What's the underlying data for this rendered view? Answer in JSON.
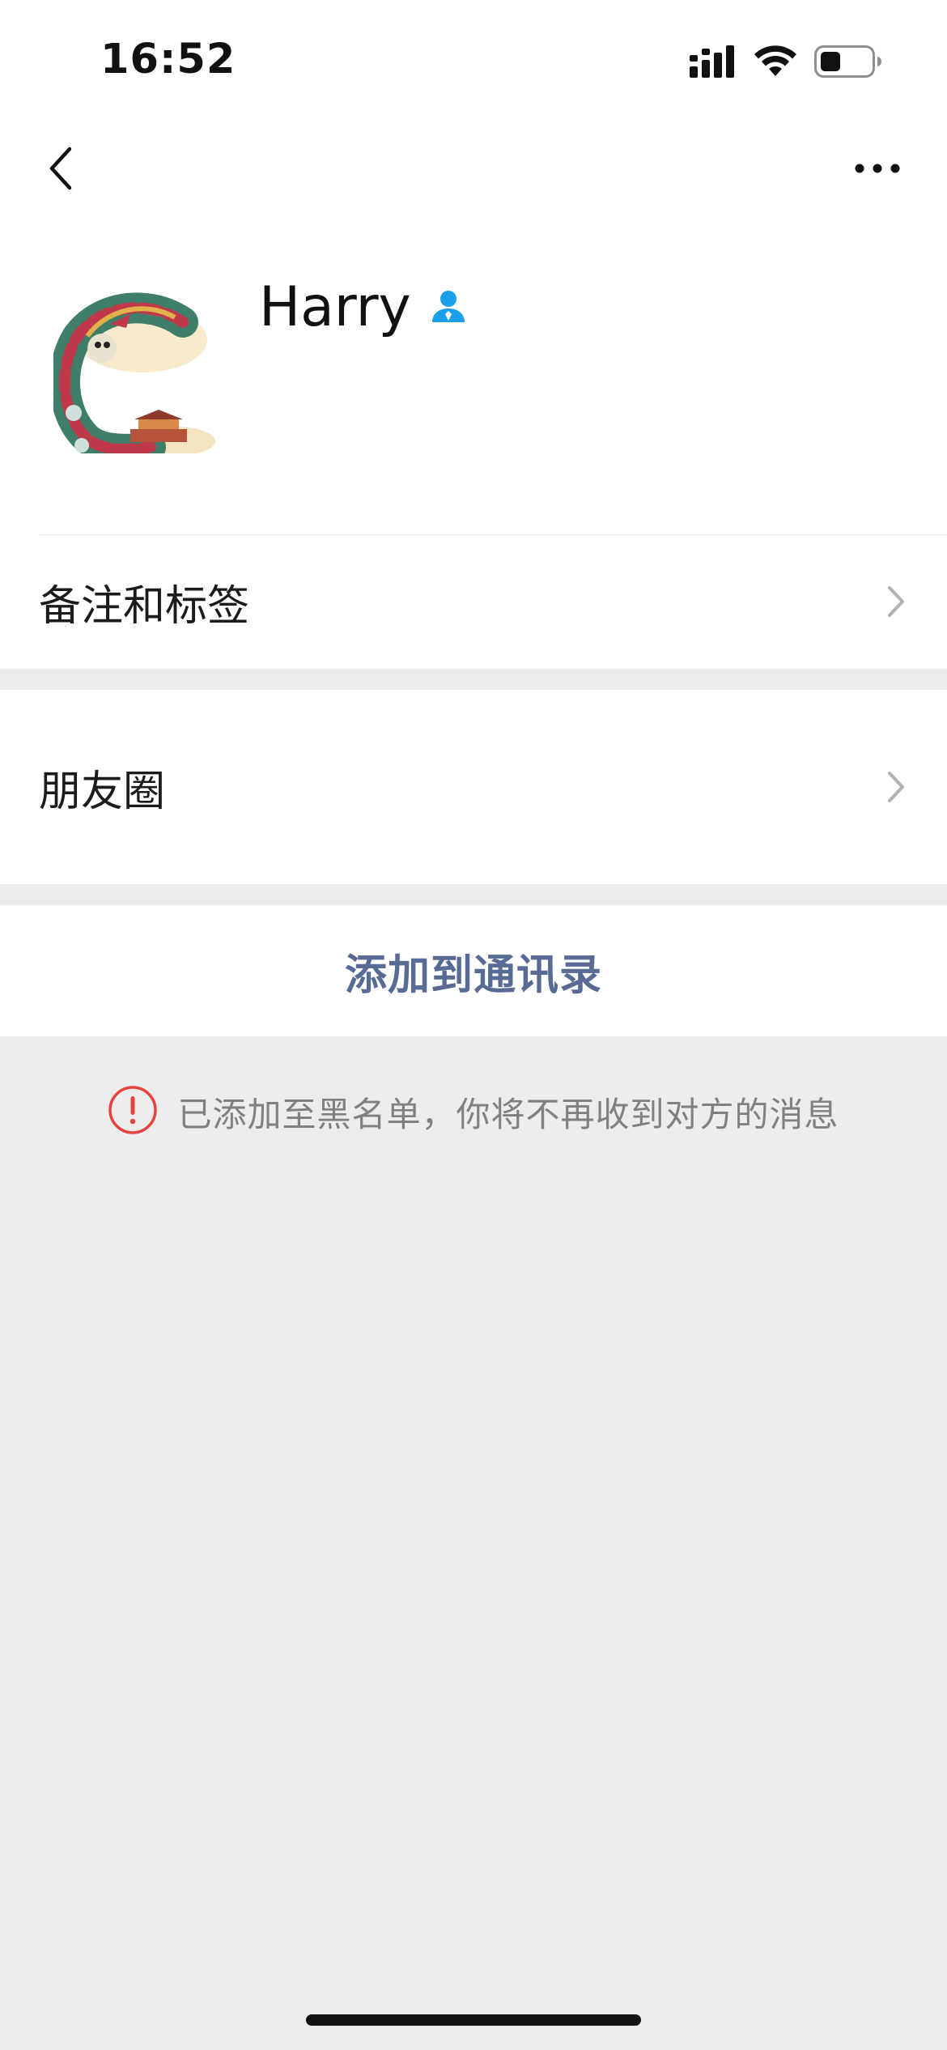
{
  "status_bar": {
    "time": "16:52",
    "icons": [
      "cellular-signal-icon",
      "wifi-icon",
      "battery-icon"
    ]
  },
  "nav": {
    "back_icon": "chevron-left-icon",
    "more_icon": "more-dots-icon"
  },
  "profile": {
    "name": "Harry",
    "avatar_icon": "dragon-letter-c-avatar",
    "badge_icon": "person-icon",
    "badge_color": "#1aa0e8"
  },
  "cells": [
    {
      "label": "备注和标签"
    },
    {
      "label": "朋友圈"
    }
  ],
  "action": {
    "label": "添加到通讯录",
    "color": "#576b95"
  },
  "notice": {
    "icon": "warning-circle-icon",
    "icon_color": "#e64340",
    "text": "已添加至黑名单，你将不再收到对方的消息"
  },
  "colors": {
    "background": "#ededed",
    "surface": "#ffffff"
  }
}
